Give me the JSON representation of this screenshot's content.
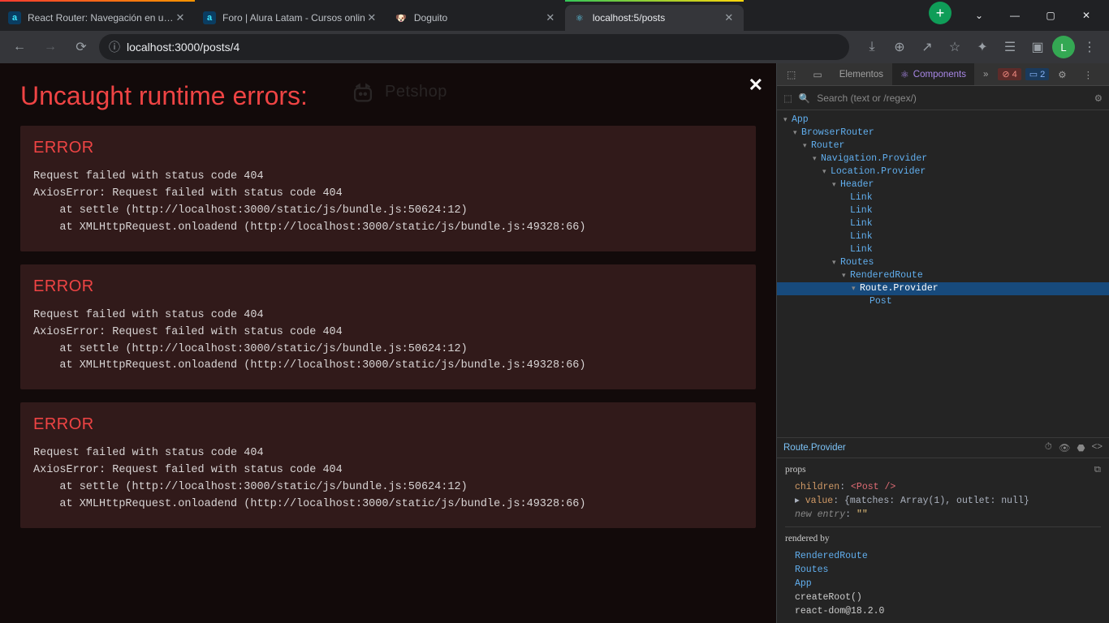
{
  "tabs": [
    {
      "title": "React Router: Navegación en una",
      "fav": "a"
    },
    {
      "title": "Foro | Alura Latam - Cursos onlin",
      "fav": "a"
    },
    {
      "title": "Doguito",
      "fav": "d"
    },
    {
      "title": "localhost:5/posts",
      "fav": "react",
      "active": true
    }
  ],
  "omnibox": {
    "url": "localhost:3000/posts/4"
  },
  "avatar": "L",
  "page": {
    "heading": "Uncaught runtime errors:",
    "logo_text": "Petshop",
    "errors": [
      {
        "title": "ERROR",
        "lines": [
          "Request failed with status code 404",
          "AxiosError: Request failed with status code 404",
          "    at settle (http://localhost:3000/static/js/bundle.js:50624:12)",
          "    at XMLHttpRequest.onloadend (http://localhost:3000/static/js/bundle.js:49328:66)"
        ]
      },
      {
        "title": "ERROR",
        "lines": [
          "Request failed with status code 404",
          "AxiosError: Request failed with status code 404",
          "    at settle (http://localhost:3000/static/js/bundle.js:50624:12)",
          "    at XMLHttpRequest.onloadend (http://localhost:3000/static/js/bundle.js:49328:66)"
        ]
      },
      {
        "title": "ERROR",
        "lines": [
          "Request failed with status code 404",
          "AxiosError: Request failed with status code 404",
          "    at settle (http://localhost:3000/static/js/bundle.js:50624:12)",
          "    at XMLHttpRequest.onloadend (http://localhost:3000/static/js/bundle.js:49328:66)"
        ]
      }
    ]
  },
  "devtools": {
    "tabs": {
      "elements": "Elementos",
      "components": "Components"
    },
    "badges": {
      "errors": "4",
      "info": "2"
    },
    "search_placeholder": "Search (text or /regex/)",
    "tree": [
      {
        "depth": 0,
        "label": "App",
        "arrow": "▾"
      },
      {
        "depth": 1,
        "label": "BrowserRouter",
        "arrow": "▾"
      },
      {
        "depth": 2,
        "label": "Router",
        "arrow": "▾"
      },
      {
        "depth": 3,
        "label": "Navigation.Provider",
        "arrow": "▾"
      },
      {
        "depth": 4,
        "label": "Location.Provider",
        "arrow": "▾"
      },
      {
        "depth": 5,
        "label": "Header",
        "arrow": "▾"
      },
      {
        "depth": 6,
        "label": "Link",
        "arrow": ""
      },
      {
        "depth": 6,
        "label": "Link",
        "arrow": ""
      },
      {
        "depth": 6,
        "label": "Link",
        "arrow": ""
      },
      {
        "depth": 6,
        "label": "Link",
        "arrow": ""
      },
      {
        "depth": 6,
        "label": "Link",
        "arrow": ""
      },
      {
        "depth": 5,
        "label": "Routes",
        "arrow": "▾"
      },
      {
        "depth": 6,
        "label": "RenderedRoute",
        "arrow": "▾"
      },
      {
        "depth": 7,
        "label": "Route.Provider",
        "arrow": "▾",
        "sel": true
      },
      {
        "depth": 8,
        "label": "Post",
        "arrow": ""
      }
    ],
    "selected": "Route.Provider",
    "props": {
      "title": "props",
      "children_key": "children",
      "children_val": "<Post />",
      "value_key": "value",
      "value_val": "{matches: Array(1), outlet: null}",
      "new_entry": "new entry",
      "new_entry_val": "\"\""
    },
    "rendered": {
      "title": "rendered by",
      "items": [
        "RenderedRoute",
        "Routes",
        "App",
        "createRoot()",
        "react-dom@18.2.0"
      ]
    }
  }
}
